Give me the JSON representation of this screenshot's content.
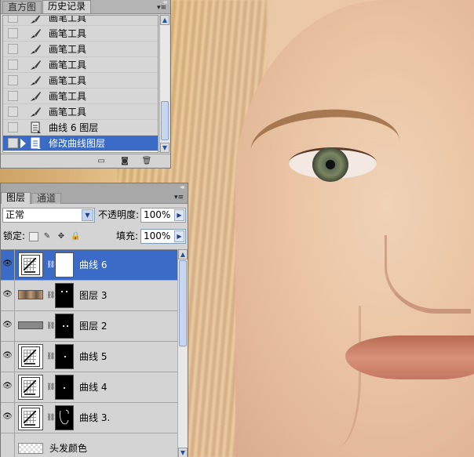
{
  "history_panel": {
    "tabs": [
      {
        "label": "直方图",
        "active": false
      },
      {
        "label": "历史记录",
        "active": true
      }
    ],
    "items": [
      {
        "label": "画笔工具",
        "icon": "brush-icon",
        "selected": false,
        "partial": true
      },
      {
        "label": "画笔工具",
        "icon": "brush-icon",
        "selected": false
      },
      {
        "label": "画笔工具",
        "icon": "brush-icon",
        "selected": false
      },
      {
        "label": "画笔工具",
        "icon": "brush-icon",
        "selected": false
      },
      {
        "label": "画笔工具",
        "icon": "brush-icon",
        "selected": false
      },
      {
        "label": "画笔工具",
        "icon": "brush-icon",
        "selected": false
      },
      {
        "label": "画笔工具",
        "icon": "brush-icon",
        "selected": false
      },
      {
        "label": "曲线 6 图层",
        "icon": "adjustment-layer-icon",
        "selected": false
      },
      {
        "label": "修改曲线图层",
        "icon": "adjustment-layer-icon",
        "selected": true
      }
    ],
    "bottom_icons": [
      "new-document-from-state-icon",
      "camera-icon",
      "trash-icon"
    ]
  },
  "layers_panel": {
    "tabs": [
      {
        "label": "图层",
        "active": true
      },
      {
        "label": "通道",
        "active": false
      }
    ],
    "blend_mode": "正常",
    "opacity_label": "不透明度:",
    "opacity_value": "100%",
    "lock_label": "锁定:",
    "fill_label": "填充:",
    "fill_value": "100%",
    "layers": [
      {
        "name": "曲线 6",
        "thumb": "curves",
        "mask": "white",
        "selected": true,
        "visible": true
      },
      {
        "name": "图层 3",
        "thumb": "eyes",
        "mask": "black",
        "selected": false,
        "visible": true
      },
      {
        "name": "图层 2",
        "thumb": "gray",
        "mask": "black",
        "selected": false,
        "visible": true
      },
      {
        "name": "曲线 5",
        "thumb": "curves",
        "mask": "black",
        "selected": false,
        "visible": true
      },
      {
        "name": "曲线 4",
        "thumb": "curves",
        "mask": "black",
        "selected": false,
        "visible": true
      },
      {
        "name": "曲线 3.",
        "thumb": "curves",
        "mask": "black",
        "selected": false,
        "visible": true
      },
      {
        "name": "头发颜色",
        "thumb": "checker",
        "mask": "none",
        "selected": false,
        "visible": false
      }
    ]
  }
}
